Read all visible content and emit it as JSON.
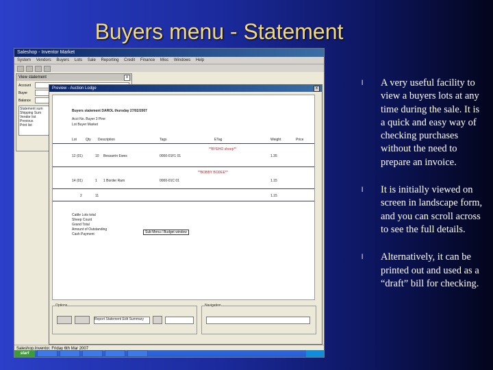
{
  "slide": {
    "title": "Buyers menu -  Statement",
    "bullets": [
      "A very useful facility to view a buyers lots at any time during the sale. It is a quick and easy way of checking purchases without the need to prepare an invoice.",
      "It is initially viewed on screen in landscape form, and you can scroll across to see the full details.",
      "Alternatively, it can be printed out and used as a “draft” bill for checking."
    ],
    "bullet_glyph": "l"
  },
  "screenshot": {
    "window_title": "Saleshop - Inventor Market",
    "menu": [
      "System",
      "Vendors",
      "Buyers",
      "Lots",
      "Sale",
      "Reporting",
      "Credit",
      "Finance",
      "Misc",
      "Windows",
      "Help"
    ],
    "view_statement": {
      "title": "View statement",
      "close": "x",
      "fields": [
        "Account",
        "Buyer",
        "Balance"
      ],
      "list": [
        "Statement sum",
        "Shipping Sum",
        "Vendor list",
        "Previous",
        "Print list"
      ]
    },
    "report_preview": {
      "title": "Preview - Auction Lodge",
      "close": "x",
      "heading": "Buyers statement DAROL thursday 27/02/2007",
      "subheading": [
        "Acct No. Buyer 3 Pine",
        "Lot Buyer Market"
      ],
      "columns": [
        "Lot",
        "Qty",
        "Description",
        "Tags",
        "ETag",
        "Weight",
        "Price"
      ],
      "markers": [
        "**BYEHO sheep**",
        "**BOBBY BODEE**"
      ],
      "rows": [
        [
          "12 (01)",
          "10",
          "Bessarrin Ewes",
          "0000-01F1 01",
          "1.35"
        ],
        [
          "14 (01)",
          "1",
          "1 Border Ram",
          "0000-01C 01",
          "1.15"
        ],
        [
          "2",
          "11",
          "",
          "",
          "1.15"
        ]
      ],
      "summary": [
        "Cattle Lots total",
        "Sheep Count",
        "Grand Total",
        "Amount of Outstanding",
        "Cash Payment"
      ],
      "button": "Sub Menu / Budget window"
    },
    "footer_group": "Options",
    "footer_select": "Report Statement Edit Summary",
    "nav_group": "Navigation",
    "status": "Saleshop.Inventor. Friday 6th Mar 2007",
    "start_label": "start"
  },
  "colors": {
    "title": "#f4d97a",
    "text": "#ffffff",
    "background_start": "#2b3fc8",
    "background_end": "#03051c"
  }
}
